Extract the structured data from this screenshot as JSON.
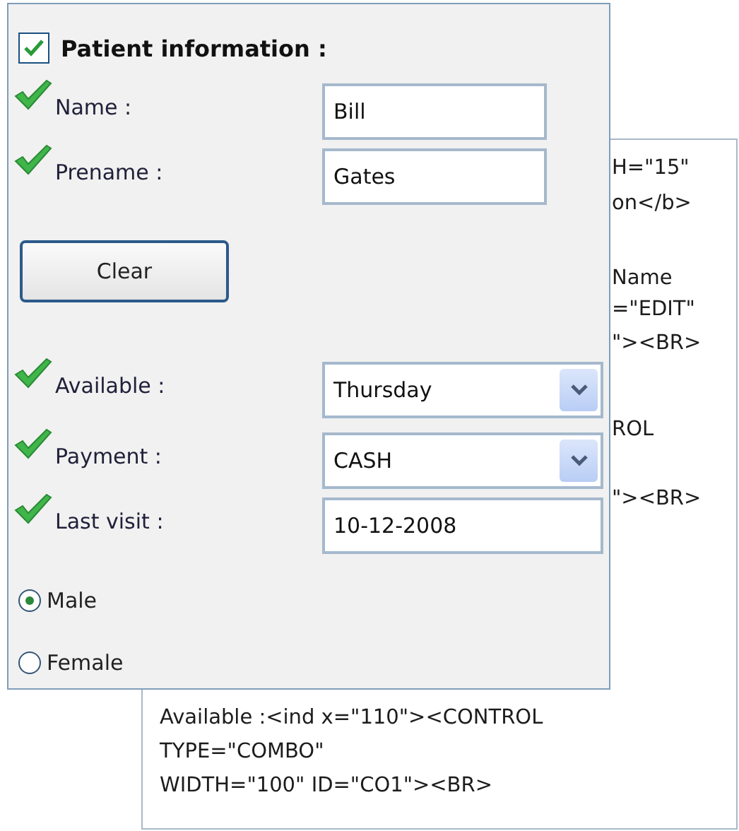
{
  "source": {
    "fragments": [
      "H=\"15\"",
      "on</b>",
      "Name",
      "=\"EDIT\"",
      "\"><BR>",
      "ROL",
      "\"><BR>"
    ],
    "lines": [
      "Available :<ind x=\"110\"><CONTROL",
      "TYPE=\"COMBO\"",
      "WIDTH=\"100\" ID=\"CO1\"><BR>"
    ]
  },
  "panel": {
    "enabled": {
      "checked": true
    },
    "title": "Patient information :",
    "fields": [
      {
        "kind": "text",
        "label": "Name :",
        "value": "Bill",
        "valid": true
      },
      {
        "kind": "text",
        "label": "Prename :",
        "value": "Gates",
        "valid": true
      }
    ],
    "clear_button": "Clear",
    "choices": [
      {
        "kind": "combo",
        "label": "Available :",
        "value": "Thursday",
        "valid": true
      },
      {
        "kind": "combo",
        "label": "Payment :",
        "value": "CASH",
        "valid": true
      },
      {
        "kind": "text",
        "label": "Last visit :",
        "value": "10-12-2008",
        "valid": true
      }
    ],
    "gender": [
      {
        "label": "Male",
        "selected": true
      },
      {
        "label": "Female",
        "selected": false
      }
    ]
  }
}
